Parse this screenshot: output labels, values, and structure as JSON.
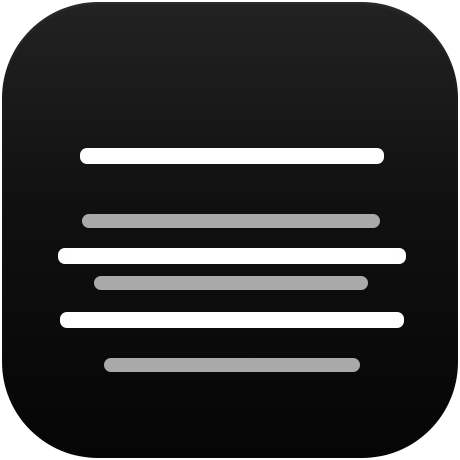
{
  "icon": {
    "name": "text-lines-app-icon",
    "background": "#111111"
  },
  "lines": [
    {
      "tone": "primary",
      "color": "#ffffff"
    },
    {
      "tone": "secondary",
      "color": "#a9a9a9"
    },
    {
      "tone": "primary",
      "color": "#ffffff"
    },
    {
      "tone": "secondary",
      "color": "#a9a9a9"
    },
    {
      "tone": "primary",
      "color": "#ffffff"
    },
    {
      "tone": "secondary",
      "color": "#a9a9a9"
    }
  ]
}
